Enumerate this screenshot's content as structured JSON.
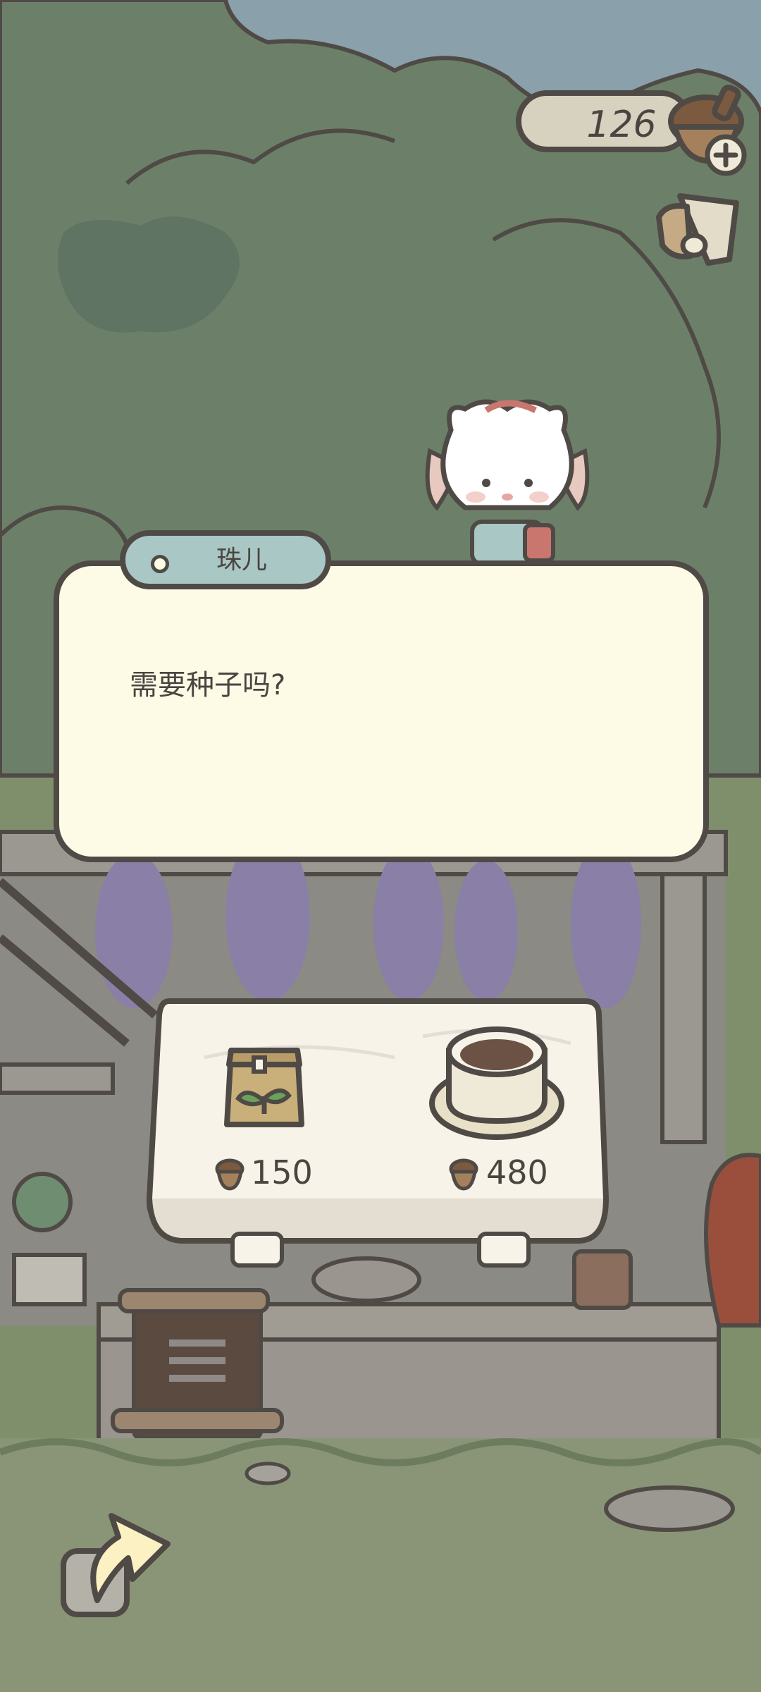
{
  "currency": {
    "amount": "126",
    "icon": "acorn-icon"
  },
  "top_buttons": {
    "add": "plus-icon",
    "wardrobe": "hat-icon"
  },
  "dialog": {
    "speaker": "珠儿",
    "text": "需要种子吗?"
  },
  "shop_items": [
    {
      "name": "seed-bag",
      "icon": "seed-bag-icon",
      "price": "150"
    },
    {
      "name": "tea-cup",
      "icon": "teacup-icon",
      "price": "480"
    }
  ],
  "back_icon": "back-arrow-icon",
  "colors": {
    "outline": "#4f4a45",
    "dialog_bg": "#fdfbe6",
    "name_tag_bg": "#a9c7c4",
    "grass": "#7f8f6c",
    "sky": "#8aa0aa"
  }
}
